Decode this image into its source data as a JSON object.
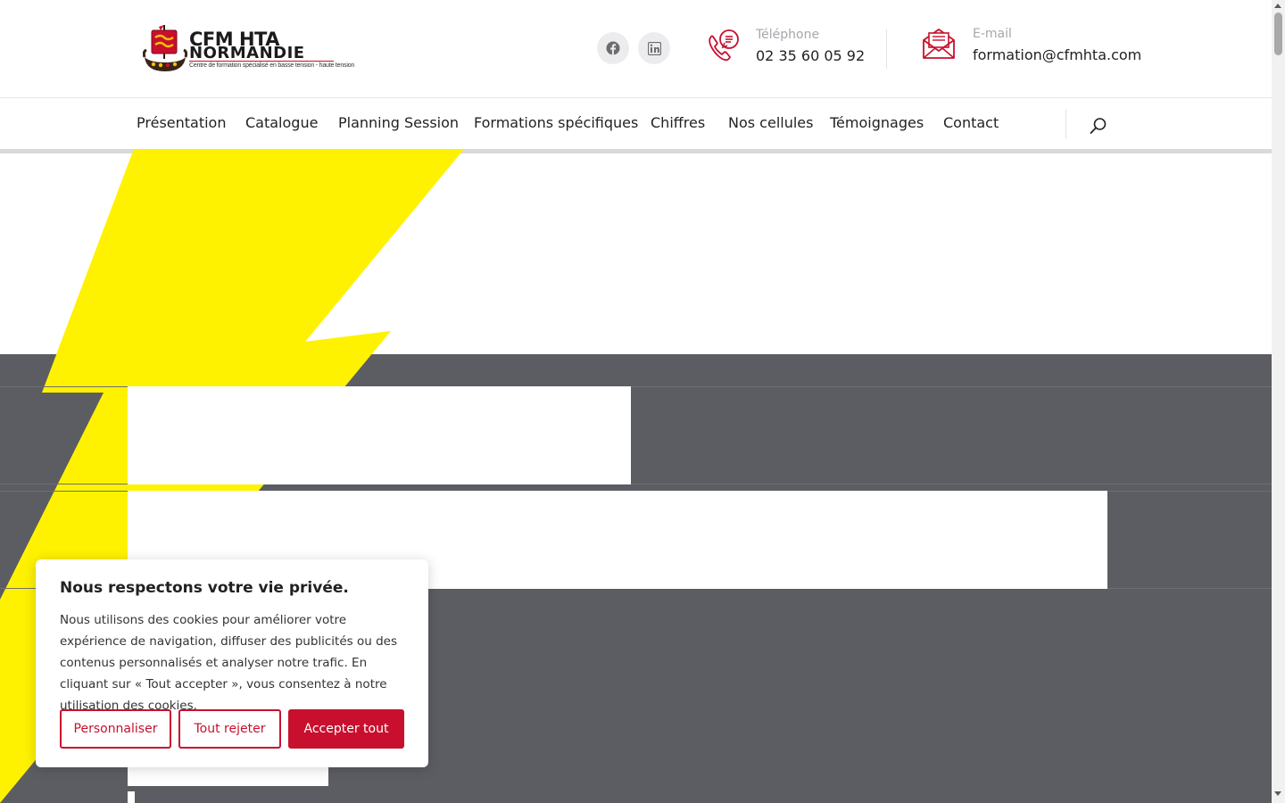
{
  "brand": {
    "name_line1": "CFM HTA",
    "name_line2": "NORMANDIE",
    "tagline": "Centre de formation spécialisé en basse tension - haute tension",
    "accent_color": "#c8102e"
  },
  "header": {
    "social": [
      {
        "icon": "facebook-icon"
      },
      {
        "icon": "linkedin-icon"
      }
    ],
    "phone": {
      "icon": "phone-icon",
      "label": "Téléphone",
      "value": "02 35 60 05 92"
    },
    "email": {
      "icon": "mail-icon",
      "label": "E-mail",
      "value": "formation@cfmhta.com"
    }
  },
  "nav": {
    "items": [
      "Présentation",
      "Catalogue",
      "Planning Session",
      "Formations spécifiques",
      "Chiffres",
      "Nos cellules",
      "Témoignages",
      "Contact"
    ],
    "search_icon": "search-icon"
  },
  "hero": {
    "background": "#5c5d62",
    "bolt_color": "#fef200"
  },
  "cookie_banner": {
    "title": "Nous respectons votre vie privée.",
    "text": "Nous utilisons des cookies pour améliorer votre expérience de navigation, diffuser des publicités ou des contenus personnalisés et analyser notre trafic. En cliquant sur « Tout accepter », vous consentez à notre utilisation des cookies.",
    "buttons": {
      "customize": "Personnaliser",
      "reject": "Tout rejeter",
      "accept": "Accepter tout"
    }
  }
}
